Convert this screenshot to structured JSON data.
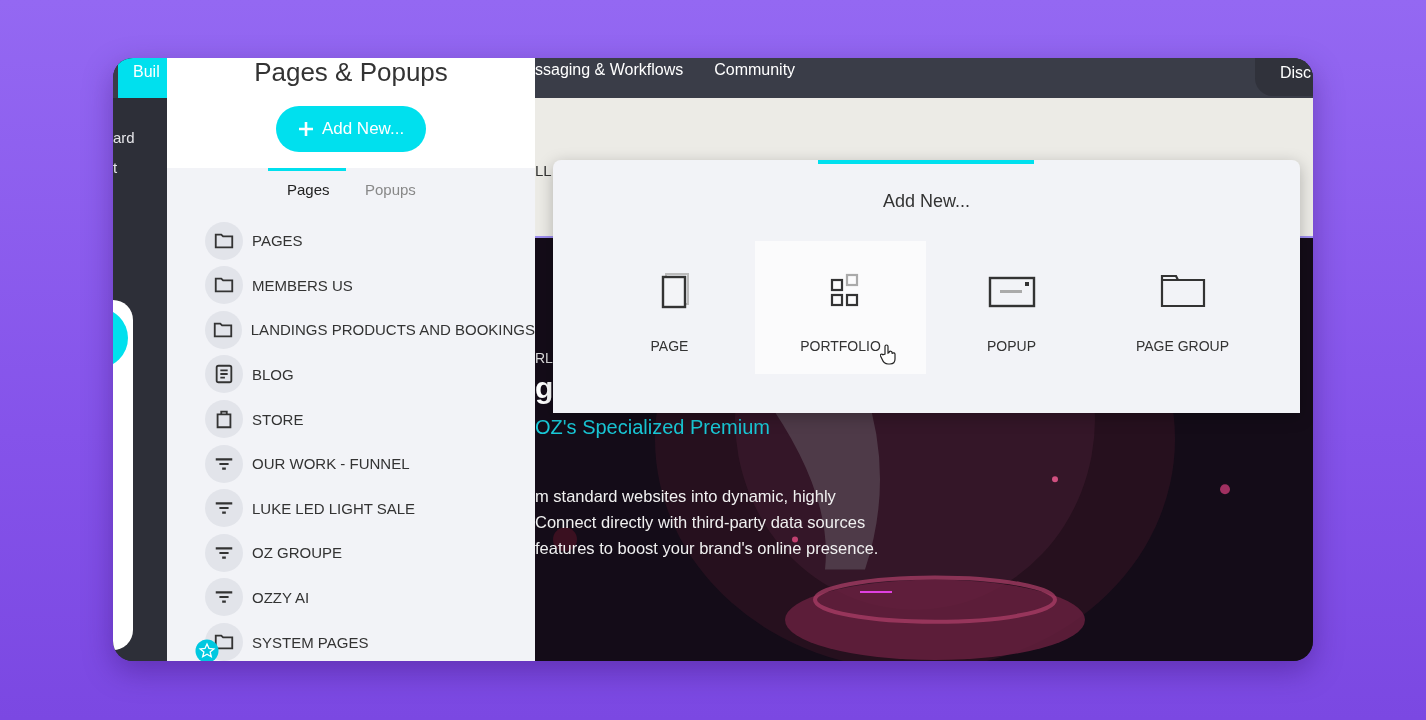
{
  "nav": {
    "tabs": [
      {
        "label": "Buil",
        "selected": true
      },
      {
        "label": "ssaging & Workflows",
        "selected": false
      },
      {
        "label": "Community",
        "selected": false
      }
    ],
    "account_button": "Disc"
  },
  "sidebar": {
    "items": [
      "ard",
      "t"
    ]
  },
  "panel": {
    "title": "Pages & Popups",
    "add_button": "Add New...",
    "tabs": [
      {
        "label": "Pages",
        "selected": true
      },
      {
        "label": "Popups",
        "selected": false
      }
    ],
    "items": [
      {
        "kind": "folder",
        "label": "PAGES"
      },
      {
        "kind": "folder",
        "label": "MEMBERS US"
      },
      {
        "kind": "folder",
        "label": "LANDINGS PRODUCTS AND BOOKINGS"
      },
      {
        "kind": "blog",
        "label": "BLOG"
      },
      {
        "kind": "store",
        "label": "STORE"
      },
      {
        "kind": "funnel",
        "label": "OUR WORK - FUNNEL"
      },
      {
        "kind": "funnel",
        "label": "LUKE LED LIGHT SALE"
      },
      {
        "kind": "funnel",
        "label": "OZ GROUPE"
      },
      {
        "kind": "funnel",
        "label": "OZZY AI"
      },
      {
        "kind": "folder",
        "label": "SYSTEM PAGES"
      }
    ]
  },
  "page": {
    "band_text": "LL",
    "eyebrow": "RL",
    "heading": "g",
    "subtitle": "OZ's Specialized Premium",
    "body_lines": [
      "m standard websites into dynamic, highly",
      "Connect directly with third-party data sources",
      "features to boost your brand's online presence."
    ]
  },
  "popup": {
    "title": "Add New...",
    "options": [
      {
        "kind": "page",
        "label": "PAGE",
        "hovered": false
      },
      {
        "kind": "portfolio",
        "label": "PORTFOLIO",
        "hovered": true
      },
      {
        "kind": "popup",
        "label": "POPUP",
        "hovered": false
      },
      {
        "kind": "page_group",
        "label": "PAGE GROUP",
        "hovered": false
      }
    ]
  }
}
